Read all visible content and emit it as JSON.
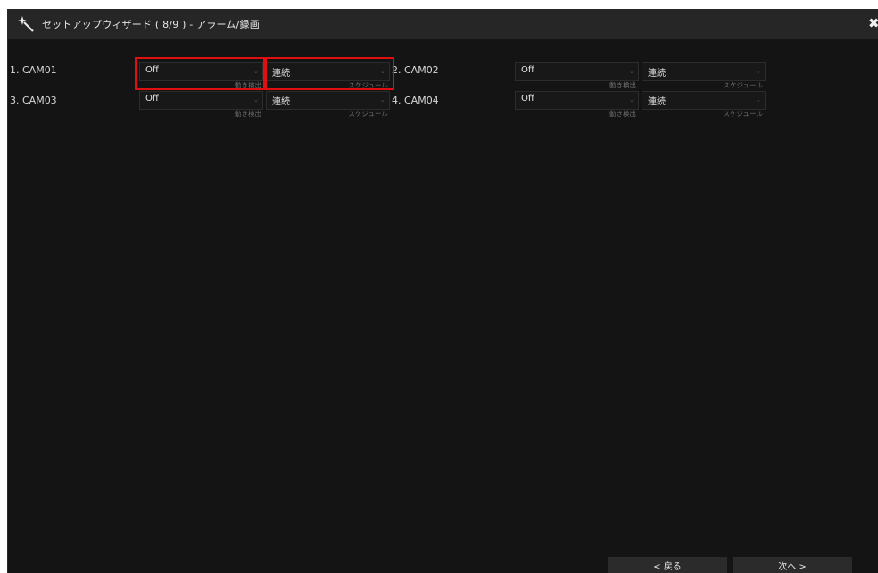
{
  "window": {
    "title": "セットアップウィザード ( 8/9 ) - アラーム/録画",
    "close_icon": "close-icon",
    "title_icon": "magic-wand-icon"
  },
  "cameras": [
    {
      "label": "1. CAM01",
      "motion_value": "Off",
      "motion_caption": "動き検出",
      "schedule_value": "連続",
      "schedule_caption": "スケジュール"
    },
    {
      "label": "2. CAM02",
      "motion_value": "Off",
      "motion_caption": "動き検出",
      "schedule_value": "連続",
      "schedule_caption": "スケジュール"
    },
    {
      "label": "3. CAM03",
      "motion_value": "Off",
      "motion_caption": "動き検出",
      "schedule_value": "連続",
      "schedule_caption": "スケジュール"
    },
    {
      "label": "4. CAM04",
      "motion_value": "Off",
      "motion_caption": "動き検出",
      "schedule_value": "連続",
      "schedule_caption": "スケジュール"
    }
  ],
  "footer": {
    "back_label": "< 戻る",
    "next_label": "次へ >"
  },
  "colors": {
    "background": "#141414",
    "titlebar": "#262626",
    "highlight": "#e01010"
  }
}
